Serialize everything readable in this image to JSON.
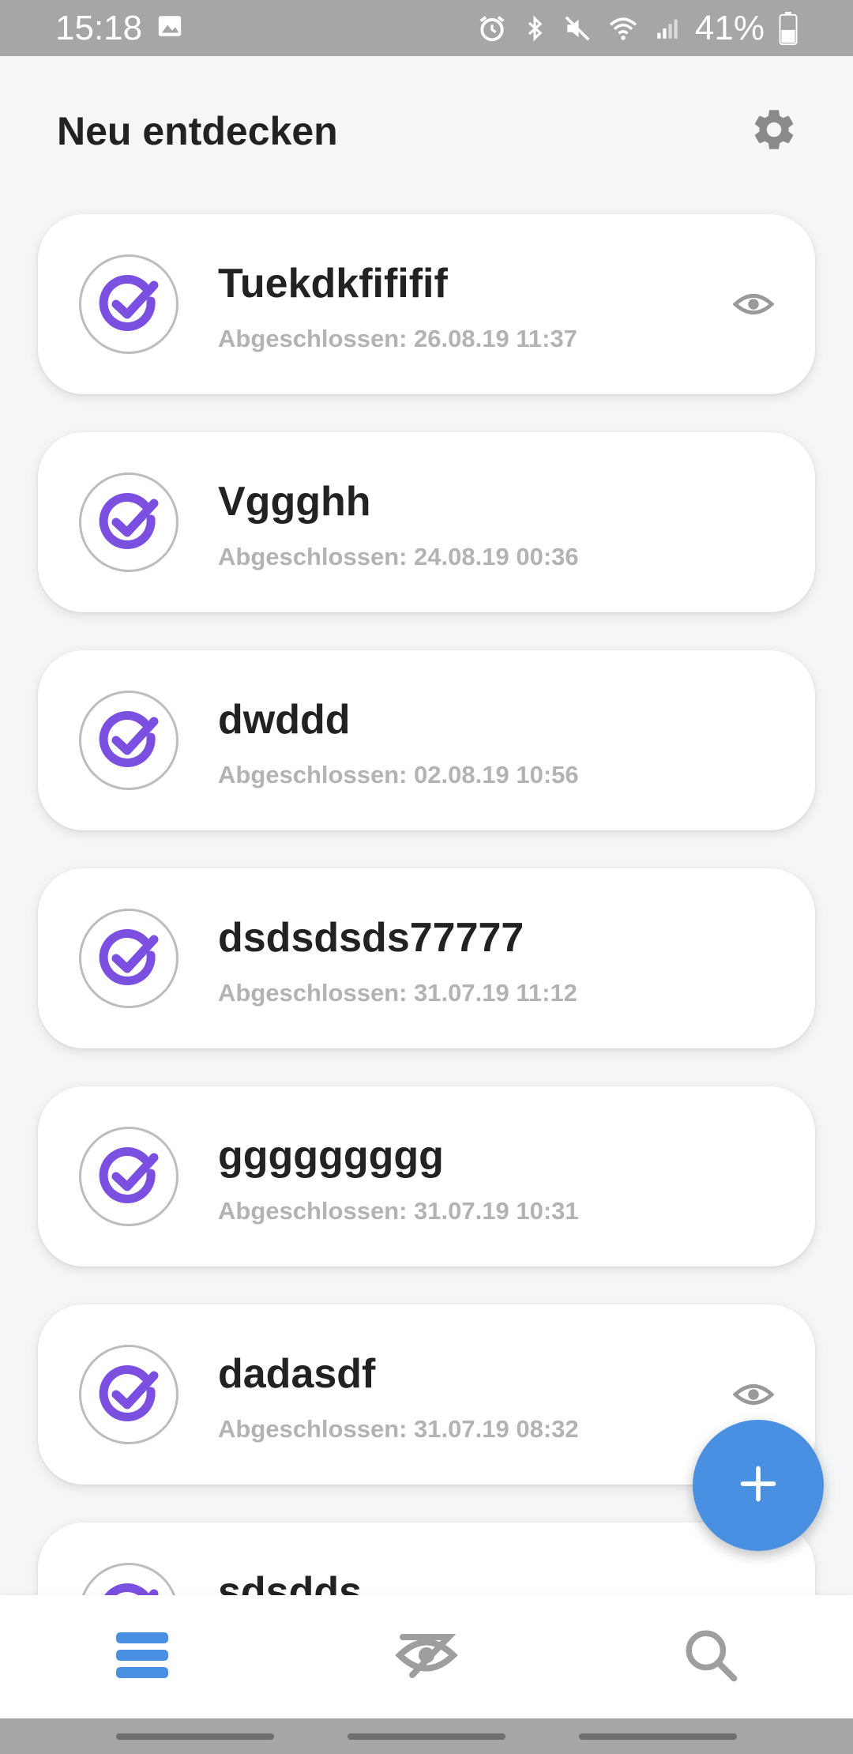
{
  "status_bar": {
    "time": "15:18",
    "battery": "41%",
    "icons": [
      "photo-notification-icon",
      "alarm-icon",
      "bluetooth-icon",
      "mute-icon",
      "wifi-icon",
      "signal-icon",
      "battery-icon"
    ]
  },
  "header": {
    "title": "Neu entdecken",
    "settings_icon": "gear-icon"
  },
  "items": [
    {
      "title": "Tuekdkfififif",
      "subtitle": "Abgeschlossen: 26.08.19 11:37",
      "has_eye": true
    },
    {
      "title": "Vggghh",
      "subtitle": "Abgeschlossen: 24.08.19 00:36",
      "has_eye": false
    },
    {
      "title": "dwddd",
      "subtitle": "Abgeschlossen: 02.08.19 10:56",
      "has_eye": false
    },
    {
      "title": "dsdsdsds77777",
      "subtitle": "Abgeschlossen: 31.07.19 11:12",
      "has_eye": false
    },
    {
      "title": "ggggggggg",
      "subtitle": "Abgeschlossen: 31.07.19 10:31",
      "has_eye": false
    },
    {
      "title": "dadasdf",
      "subtitle": "Abgeschlossen: 31.07.19 08:32",
      "has_eye": true
    },
    {
      "title": "sdsdds",
      "subtitle": "",
      "has_eye": true
    }
  ],
  "colors": {
    "accent_purple": "#7b4fe0",
    "fab_blue": "#4a90e2",
    "nav_active": "#4a90e2",
    "nav_inactive": "#9e9e9e"
  },
  "fab": {
    "icon": "plus-icon"
  },
  "bottom_nav": [
    {
      "icon": "list-icon",
      "active": true
    },
    {
      "icon": "eye-off-icon",
      "active": false
    },
    {
      "icon": "search-icon",
      "active": false
    }
  ]
}
